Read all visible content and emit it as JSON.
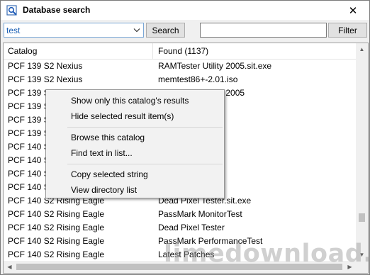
{
  "window": {
    "title": "Database search",
    "close_glyph": "✕"
  },
  "toolbar": {
    "search_value": "test",
    "search_button": "Search",
    "filter_value": "",
    "filter_button": "Filter"
  },
  "columns": [
    "Catalog",
    "Found (1137)"
  ],
  "rows": [
    [
      "PCF 139 S2 Nexius",
      "RAMTester Utility 2005.sit.exe"
    ],
    [
      "PCF 139 S2 Nexius",
      "memtest86+-2.01.iso"
    ],
    [
      "PCF 139 S2 Nexius",
      "RAMTester Utility 2005"
    ],
    [
      "PCF 139 S2 Nexius",
      ""
    ],
    [
      "PCF 139 S2 Nexius",
      ""
    ],
    [
      "PCF 139 S2 Nexius",
      ""
    ],
    [
      "PCF 140 S2 Rising Eagle",
      ""
    ],
    [
      "PCF 140 S2 Rising Eagle",
      ""
    ],
    [
      "PCF 140 S2 Rising Eagle",
      "i"
    ],
    [
      "PCF 140 S2 Rising Eagle",
      ""
    ],
    [
      "PCF 140 S2 Rising Eagle",
      "Dead Pixel Tester.sit.exe"
    ],
    [
      "PCF 140 S2 Rising Eagle",
      "PassMark MonitorTest"
    ],
    [
      "PCF 140 S2 Rising Eagle",
      "Dead Pixel Tester"
    ],
    [
      "PCF 140 S2 Rising Eagle",
      "PassMark PerformanceTest"
    ],
    [
      "PCF 140 S2 Rising Eagle",
      "Latest Patches"
    ]
  ],
  "context_menu": {
    "items": [
      "Show only this catalog's results",
      "Hide selected result item(s)",
      "Browse this catalog",
      "Find text in list...",
      "Copy selected string",
      "View directory list"
    ]
  },
  "watermark": "limedownload.com",
  "colors": {
    "search_text": "#1a5fb4",
    "menu_bg": "#f2f2f2",
    "watermark": "#969696"
  }
}
